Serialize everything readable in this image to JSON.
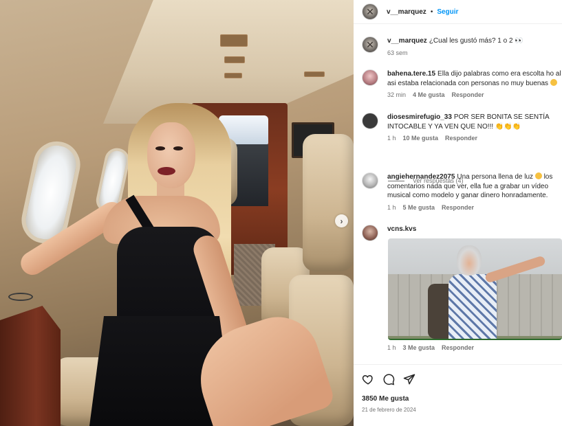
{
  "post": {
    "author": "v__marquez",
    "follow_label": "Seguir",
    "separator": "•",
    "caption_text": "¿Cual les gustó más? 1 o 2",
    "caption_emoji": "👀",
    "caption_time": "63 sem",
    "next_arrow": "›"
  },
  "comments": [
    {
      "user": "bahena.tere.15",
      "text": "Ella dijo palabras como era escolta ho al asi estaba relacionada con personas no muy buenas",
      "time": "32 min",
      "likes": "4 Me gusta",
      "reply": "Responder"
    },
    {
      "user": "diosesmirefugio_33",
      "text": "POR SER BONITA SE SENTÍA INTOCABLE Y YA VEN QUE NO!!!",
      "emoji": "👏👏👏",
      "time": "1 h",
      "likes": "10 Me gusta",
      "reply": "Responder",
      "view_replies": "Ver respuestas (4)"
    },
    {
      "user": "angiehernandez2075",
      "text_before": "Una persona llena de luz",
      "text_after": "los comentarios nada que ver, ella fue a grabar un vídeo musical como modelo y ganar dinero honradamente.",
      "time": "1 h",
      "likes": "5 Me gusta",
      "reply": "Responder"
    },
    {
      "user": "vcns.kvs",
      "time": "1 h",
      "likes": "3 Me gusta",
      "reply": "Responder"
    }
  ],
  "footer": {
    "likes_count": "3850 Me gusta",
    "date": "21 de febrero de 2024"
  },
  "icons": [
    "x-avatar-icon",
    "chevron-right-icon",
    "heart-icon",
    "comment-icon",
    "share-icon"
  ],
  "colors": {
    "follow_blue": "#0095f6",
    "meta_gray": "#737373",
    "text": "#262626"
  }
}
